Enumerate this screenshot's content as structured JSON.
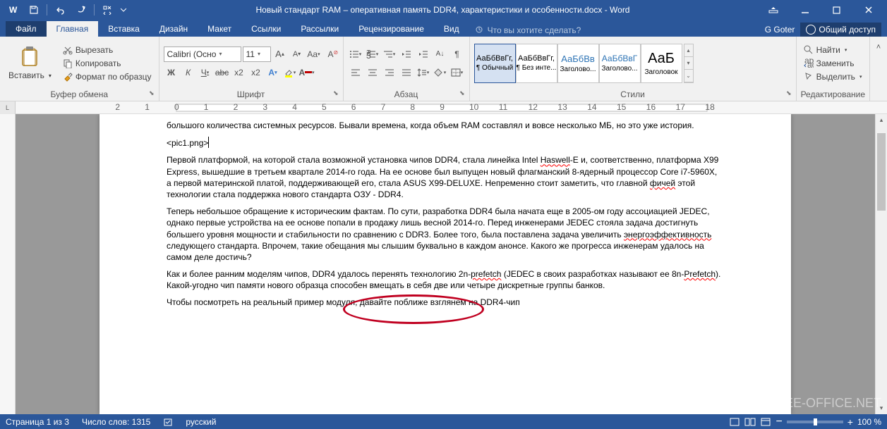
{
  "title": "Новый стандарт RAM – оперативная память DDR4, характеристики и особенности.docx - Word",
  "user": "G Goter",
  "share": "Общий доступ",
  "tabs": {
    "file": "Файл",
    "home": "Главная",
    "insert": "Вставка",
    "design": "Дизайн",
    "layout": "Макет",
    "references": "Ссылки",
    "mailings": "Рассылки",
    "review": "Рецензирование",
    "view": "Вид"
  },
  "tellme": "Что вы хотите сделать?",
  "clipboard": {
    "paste": "Вставить",
    "cut": "Вырезать",
    "copy": "Копировать",
    "painter": "Формат по образцу",
    "label": "Буфер обмена"
  },
  "font": {
    "name": "Calibri (Осно",
    "size": "11",
    "label": "Шрифт"
  },
  "paragraph": {
    "label": "Абзац"
  },
  "styles": {
    "label": "Стили",
    "items": [
      {
        "prev": "АаБбВвГг,",
        "name": "¶ Обычный"
      },
      {
        "prev": "АаБбВвГг,",
        "name": "¶ Без инте..."
      },
      {
        "prev": "АаБбВв",
        "name": "Заголово..."
      },
      {
        "prev": "АаБбВвГ",
        "name": "Заголово..."
      },
      {
        "prev": "АаБ",
        "name": "Заголовок"
      }
    ]
  },
  "editing": {
    "find": "Найти",
    "replace": "Заменить",
    "select": "Выделить",
    "label": "Редактирование"
  },
  "doc": {
    "p1": "большого количества системных ресурсов. Бывали времена, когда объем RAM составлял и вовсе несколько МБ, но это уже история.",
    "p2": "<pic1.png>",
    "p3a": "Первой платформой, на которой стала возможной установка чипов DDR4, стала линейка Intel ",
    "p3b": "Haswell",
    "p3c": "-E и, соответственно, платформа X99 Express, вышедшие в третьем квартале 2014-го года. На ее основе был выпущен новый флагманский 8-ядерный процессор Core i7-5960X, а первой материнской платой, поддерживающей его, стала ASUS X99-DELUXE. Непременно стоит заметить, что главной ",
    "p3d": "фичей",
    "p3e": " этой технологии стала поддержка нового стандарта ОЗУ - DDR4.",
    "p4a": "Теперь небольшое обращение к историческим фактам. По сути, разработка DDR4 была начата еще в 2005-ом году ассоциацией JEDEC, однако первые устройства на ее основе попали в продажу лишь весной 2014-го. Перед инженерами JEDEC стояла задача достигнуть большего уровня мощности и стабильности по сравнению с DDR3. Более того, была поставлена задача увеличить ",
    "p4b": "энергоэффективность",
    "p4c": " следующего стандарта. Впрочем, такие обещания мы слышим буквально в каждом анонсе. Какого же прогресса инженерам удалось на самом деле достичь?",
    "p5a": "Как и более ранним моделям чипов, DDR4 удалось перенять технологию 2n-",
    "p5b": "prefetch",
    "p5c": " (JEDEC в своих разработках называют ее 8n-",
    "p5d": "Prefetch",
    "p5e": "). Какой-угодно чип памяти нового образца способен вмещать в себя две или четыре дискретные группы банков.",
    "p6": "Чтобы посмотреть на реальный пример модуля, давайте поближе взглянем на DDR4-чип"
  },
  "status": {
    "page": "Страница 1 из 3",
    "words": "Число слов: 1315",
    "lang": "русский",
    "zoom": "100 %"
  }
}
